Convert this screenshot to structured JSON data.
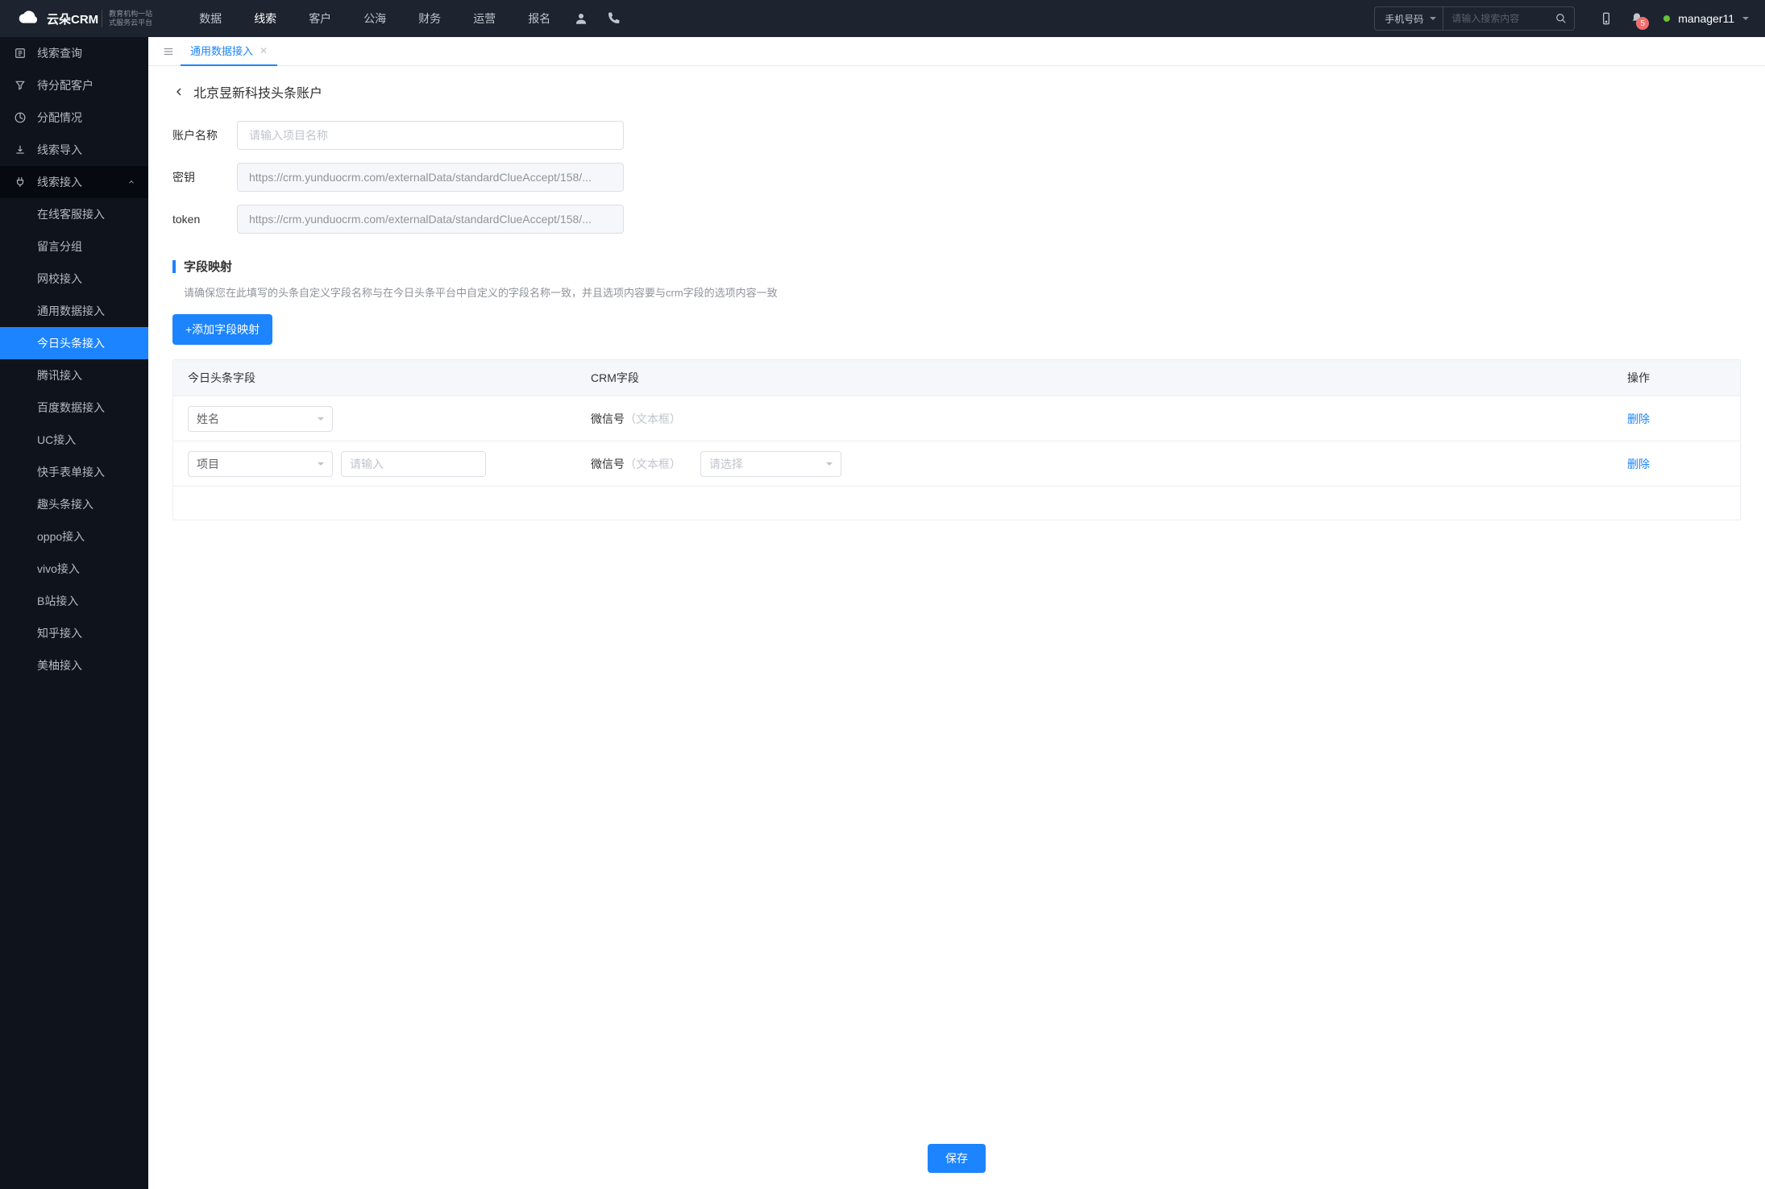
{
  "header": {
    "brand_main": "云朵CRM",
    "brand_sub1": "教育机构一站",
    "brand_sub2": "式服务云平台",
    "nav": [
      "数据",
      "线索",
      "客户",
      "公海",
      "财务",
      "运营",
      "报名"
    ],
    "nav_active": 1,
    "search_type": "手机号码",
    "search_placeholder": "请输入搜索内容",
    "badge": "5",
    "user": "manager11"
  },
  "sidebar": {
    "top": [
      {
        "label": "线索查询"
      },
      {
        "label": "待分配客户"
      },
      {
        "label": "分配情况"
      },
      {
        "label": "线索导入"
      }
    ],
    "group_label": "线索接入",
    "subs": [
      "在线客服接入",
      "留言分组",
      "网校接入",
      "通用数据接入",
      "今日头条接入",
      "腾讯接入",
      "百度数据接入",
      "UC接入",
      "快手表单接入",
      "趣头条接入",
      "oppo接入",
      "vivo接入",
      "B站接入",
      "知乎接入",
      "美柚接入"
    ],
    "active_sub": 4
  },
  "tabs": {
    "items": [
      "通用数据接入"
    ],
    "active": 0
  },
  "page": {
    "title": "北京昱新科技头条账户",
    "form": {
      "account_label": "账户名称",
      "account_placeholder": "请输入项目名称",
      "secret_label": "密钥",
      "secret_value": "https://crm.yunduocrm.com/externalData/standardClueAccept/158/...",
      "token_label": "token",
      "token_value": "https://crm.yunduocrm.com/externalData/standardClueAccept/158/..."
    },
    "section": {
      "title": "字段映射",
      "desc": "请确保您在此填写的头条自定义字段名称与在今日头条平台中自定义的字段名称一致，并且选项内容要与crm字段的选项内容一致",
      "add_btn": "+添加字段映射"
    },
    "table": {
      "headers": [
        "今日头条字段",
        "CRM字段",
        "操作"
      ],
      "rows": [
        {
          "tt_field": "姓名",
          "extra_input": false,
          "crm_field": "微信号",
          "crm_hint": "（文本框）",
          "crm_select": false
        },
        {
          "tt_field": "项目",
          "extra_input": true,
          "extra_placeholder": "请输入",
          "crm_field": "微信号",
          "crm_hint": "（文本框）",
          "crm_select": true,
          "crm_select_placeholder": "请选择"
        }
      ],
      "delete_label": "删除"
    },
    "save_btn": "保存"
  }
}
